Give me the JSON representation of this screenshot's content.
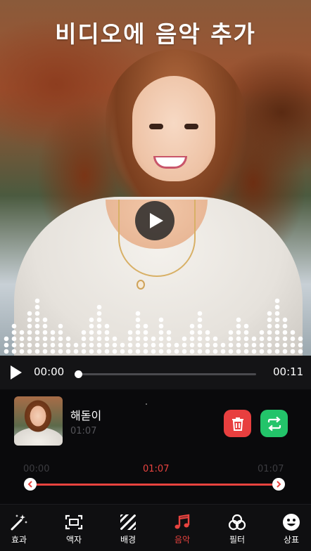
{
  "header": {
    "title": "비디오에 음악 추가"
  },
  "player": {
    "current_time": "00:00",
    "total_time": "00:11",
    "progress": 0.0
  },
  "music": {
    "name": "해돋이",
    "duration": "01:07"
  },
  "trim": {
    "start_label": "00:00",
    "mid_label": "01:07",
    "end_label": "01:07"
  },
  "nav": {
    "items": [
      {
        "label": "효과",
        "icon": "magic-wand-icon"
      },
      {
        "label": "액자",
        "icon": "frame-icon"
      },
      {
        "label": "배경",
        "icon": "stripes-icon"
      },
      {
        "label": "음악",
        "icon": "music-note-icon"
      },
      {
        "label": "필터",
        "icon": "filter-circles-icon"
      },
      {
        "label": "상표",
        "icon": "smiley-sticker-icon"
      }
    ],
    "active_index": 3
  },
  "colors": {
    "accent_red": "#e8433f",
    "delete_red": "#e83f3f",
    "replace_green": "#23c46a"
  }
}
